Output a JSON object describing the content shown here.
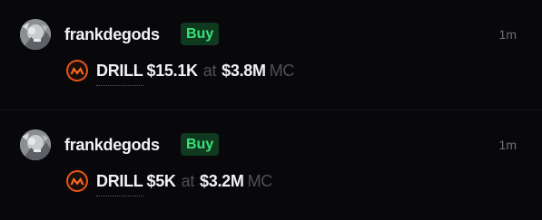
{
  "colors": {
    "background": "#08080b",
    "buy_badge_bg": "#0f3a20",
    "buy_badge_text": "#3ee07a",
    "token_accent": "#e8541a",
    "muted_text": "#4f5058"
  },
  "trades": [
    {
      "username": "frankdegods",
      "side": "Buy",
      "time": "1m",
      "avatar_icon": "user-avatar-icon",
      "token_icon": "drill-token-icon",
      "ticker": "DRILL",
      "amount": "$15.1K",
      "at": "at",
      "market_cap": "$3.8M",
      "mc_label": "MC"
    },
    {
      "username": "frankdegods",
      "side": "Buy",
      "time": "1m",
      "avatar_icon": "user-avatar-icon",
      "token_icon": "drill-token-icon",
      "ticker": "DRILL",
      "amount": "$5K",
      "at": "at",
      "market_cap": "$3.2M",
      "mc_label": "MC"
    }
  ]
}
